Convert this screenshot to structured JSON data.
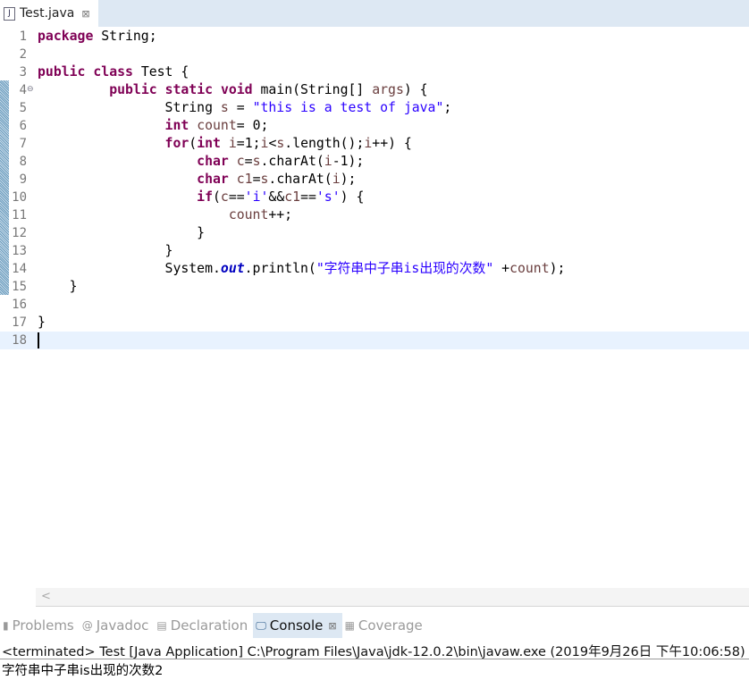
{
  "editor_tab": {
    "title": "Test.java",
    "icon": "java-file-icon",
    "close": "⊠"
  },
  "code_lines": [
    [
      [
        "k",
        "package"
      ],
      [
        "p",
        " String;"
      ]
    ],
    [],
    [
      [
        "k",
        "public"
      ],
      [
        "p",
        " "
      ],
      [
        "k",
        "class"
      ],
      [
        "p",
        " Test {"
      ]
    ],
    [
      [
        "p",
        "         "
      ],
      [
        "k",
        "public"
      ],
      [
        "p",
        " "
      ],
      [
        "k",
        "static"
      ],
      [
        "p",
        " "
      ],
      [
        "k",
        "void"
      ],
      [
        "p",
        " main(String[] "
      ],
      [
        "v",
        "args"
      ],
      [
        "p",
        ") {"
      ]
    ],
    [
      [
        "p",
        "                String "
      ],
      [
        "v",
        "s"
      ],
      [
        "p",
        " = "
      ],
      [
        "s",
        "\"this is a test of java\""
      ],
      [
        "p",
        ";"
      ]
    ],
    [
      [
        "p",
        "                "
      ],
      [
        "k",
        "int"
      ],
      [
        "p",
        " "
      ],
      [
        "v",
        "count"
      ],
      [
        "p",
        "= 0;"
      ]
    ],
    [
      [
        "p",
        "                "
      ],
      [
        "k",
        "for"
      ],
      [
        "p",
        "("
      ],
      [
        "k",
        "int"
      ],
      [
        "p",
        " "
      ],
      [
        "v",
        "i"
      ],
      [
        "p",
        "=1;"
      ],
      [
        "v",
        "i"
      ],
      [
        "p",
        "<"
      ],
      [
        "v",
        "s"
      ],
      [
        "p",
        ".length();"
      ],
      [
        "v",
        "i"
      ],
      [
        "p",
        "++) {"
      ]
    ],
    [
      [
        "p",
        "                    "
      ],
      [
        "k",
        "char"
      ],
      [
        "p",
        " "
      ],
      [
        "v",
        "c"
      ],
      [
        "p",
        "="
      ],
      [
        "v",
        "s"
      ],
      [
        "p",
        ".charAt("
      ],
      [
        "v",
        "i"
      ],
      [
        "p",
        "-1);"
      ]
    ],
    [
      [
        "p",
        "                    "
      ],
      [
        "k",
        "char"
      ],
      [
        "p",
        " "
      ],
      [
        "v",
        "c1"
      ],
      [
        "p",
        "="
      ],
      [
        "v",
        "s"
      ],
      [
        "p",
        ".charAt("
      ],
      [
        "v",
        "i"
      ],
      [
        "p",
        ");"
      ]
    ],
    [
      [
        "p",
        "                    "
      ],
      [
        "k",
        "if"
      ],
      [
        "p",
        "("
      ],
      [
        "v",
        "c"
      ],
      [
        "p",
        "=="
      ],
      [
        "s",
        "'i'"
      ],
      [
        "p",
        "&&"
      ],
      [
        "v",
        "c1"
      ],
      [
        "p",
        "=="
      ],
      [
        "s",
        "'s'"
      ],
      [
        "p",
        ") {"
      ]
    ],
    [
      [
        "p",
        "                        "
      ],
      [
        "v",
        "count"
      ],
      [
        "p",
        "++;"
      ]
    ],
    [
      [
        "p",
        "                    }"
      ]
    ],
    [
      [
        "p",
        "                }"
      ]
    ],
    [
      [
        "p",
        "                System."
      ],
      [
        "f",
        "out"
      ],
      [
        "p",
        ".println("
      ],
      [
        "s",
        "\"字符串中子串is出现的次数\""
      ],
      [
        "p",
        " +"
      ],
      [
        "v",
        "count"
      ],
      [
        "p",
        ");"
      ]
    ],
    [
      [
        "p",
        "    }"
      ]
    ],
    [],
    [
      [
        "p",
        "}"
      ]
    ],
    []
  ],
  "current_line": 18,
  "fold_line": 4,
  "panel_tabs": [
    {
      "label": "Problems",
      "icon": "problems-icon",
      "glyph": "▮"
    },
    {
      "label": "Javadoc",
      "icon": "javadoc-icon",
      "glyph": "@"
    },
    {
      "label": "Declaration",
      "icon": "declaration-icon",
      "glyph": "▤"
    },
    {
      "label": "Console",
      "icon": "console-icon",
      "glyph": "🖵",
      "active": true,
      "close": "⊠"
    },
    {
      "label": "Coverage",
      "icon": "coverage-icon",
      "glyph": "▦"
    }
  ],
  "console": {
    "status": "<terminated> Test [Java Application] C:\\Program Files\\Java\\jdk-12.0.2\\bin\\javaw.exe (2019年9月26日 下午10:06:58)",
    "output": "字符串中子串is出现的次数2"
  },
  "colors": {
    "keyword": "#7f0055",
    "string": "#2a00ff",
    "variable": "#6a3e3e",
    "static_field": "#0000c0",
    "current_line": "#e8f2fe",
    "active_tab": "#dde8f3"
  }
}
